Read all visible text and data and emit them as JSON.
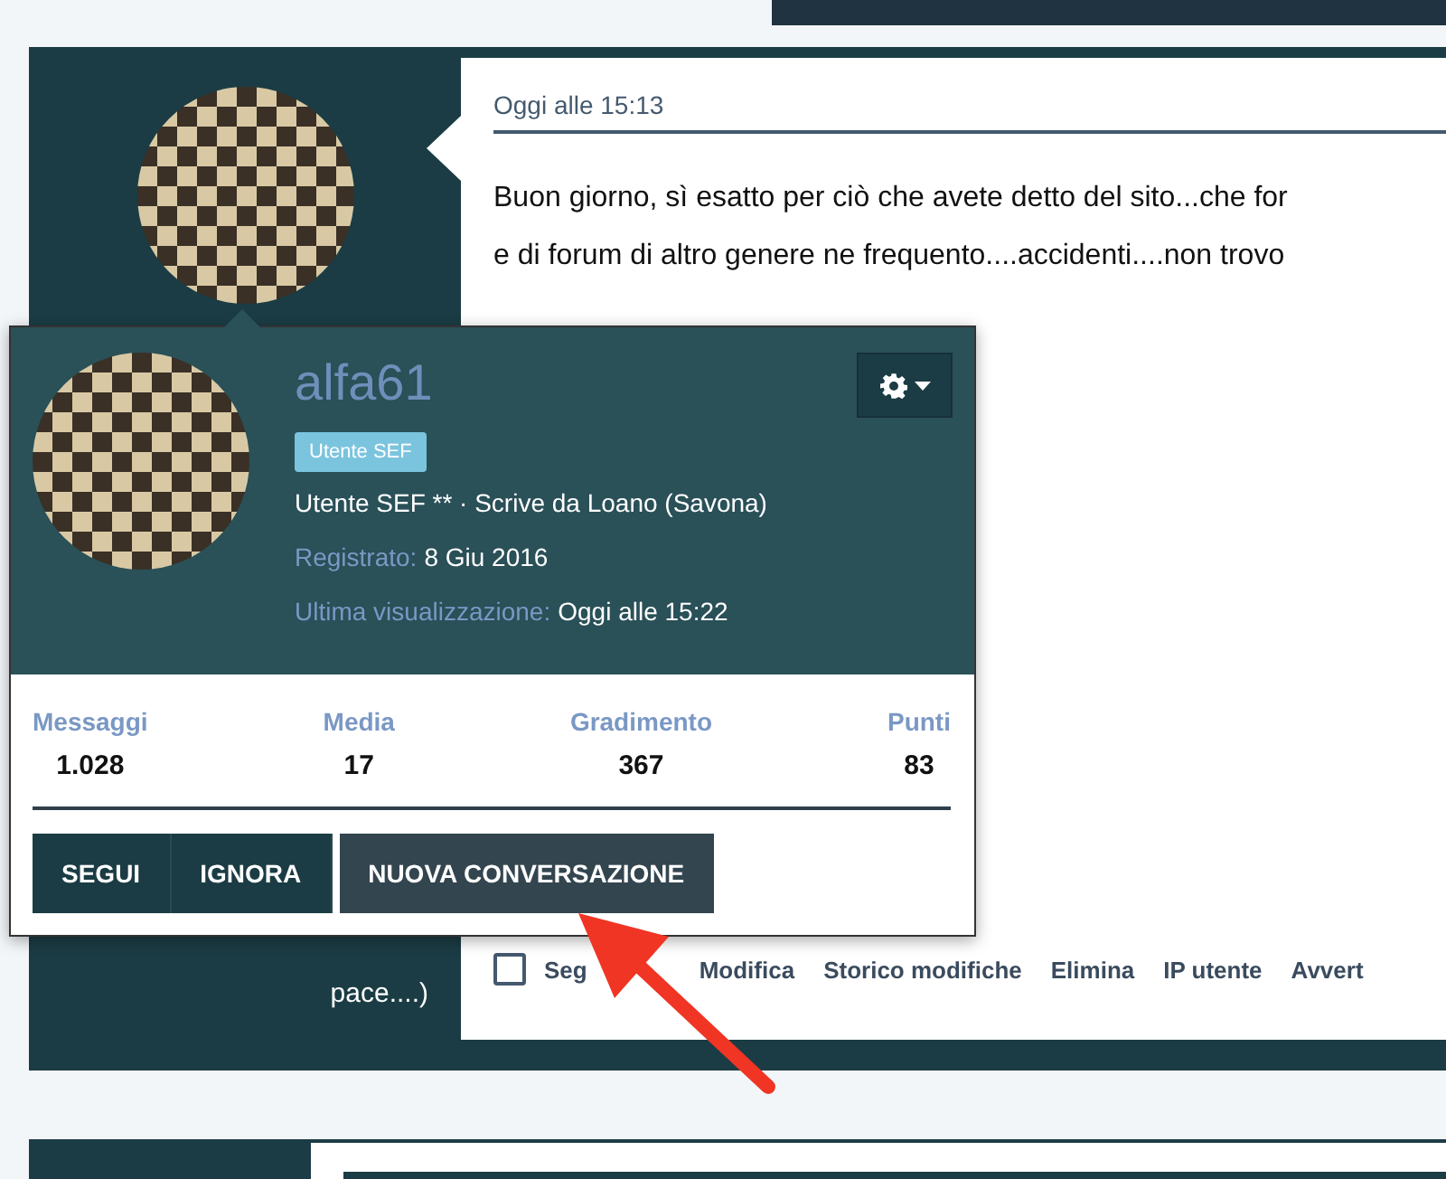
{
  "post": {
    "timestamp": "Oggi alle 15:13",
    "text_lines": [
      "Buon giorno, sì esatto per ciò che avete detto del sito...che for",
      "e di forum di altro genere ne frequento....accidenti....non trovo"
    ],
    "author_note": "pace....)",
    "select_checked": false,
    "actions": [
      {
        "label": "Seg"
      },
      {
        "label": "Modifica"
      },
      {
        "label": "Storico modifiche"
      },
      {
        "label": "Elimina"
      },
      {
        "label": "IP utente"
      },
      {
        "label": "Avvert"
      }
    ]
  },
  "user_card": {
    "username": "alfa61",
    "badge": "Utente SEF",
    "title_line": "Utente SEF ** · Scrive da Loano (Savona)",
    "details": [
      {
        "label": "Registrato:",
        "value": "8 Giu 2016"
      },
      {
        "label": "Ultima visualizzazione:",
        "value": "Oggi alle 15:22"
      }
    ],
    "stats": [
      {
        "label": "Messaggi",
        "value": "1.028"
      },
      {
        "label": "Media",
        "value": "17"
      },
      {
        "label": "Gradimento",
        "value": "367"
      },
      {
        "label": "Punti",
        "value": "83"
      }
    ],
    "buttons": [
      {
        "label": "SEGUI",
        "kind": "group"
      },
      {
        "label": "IGNORA",
        "kind": "group"
      },
      {
        "label": "NUOVA CONVERSAZIONE",
        "kind": "single"
      }
    ]
  }
}
